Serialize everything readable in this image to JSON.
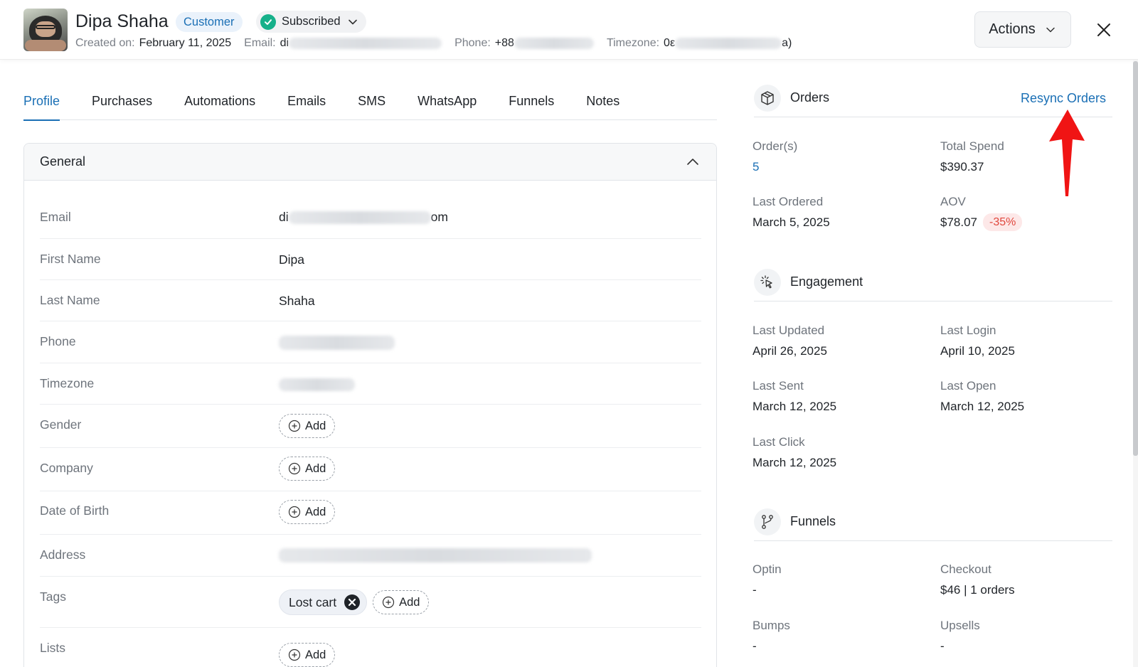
{
  "header": {
    "name": "Dipa Shaha",
    "badge": "Customer",
    "subscription_status": "Subscribed",
    "created_label": "Created on:",
    "created_value": "February 11, 2025",
    "email_label": "Email:",
    "email_visible": "di",
    "phone_label": "Phone:",
    "phone_visible": "+88",
    "timezone_label": "Timezone:",
    "timezone_visible": "0ε",
    "timezone_tail": "a)",
    "actions_label": "Actions"
  },
  "tabs": [
    {
      "label": "Profile",
      "active": true
    },
    {
      "label": "Purchases"
    },
    {
      "label": "Automations"
    },
    {
      "label": "Emails"
    },
    {
      "label": "SMS"
    },
    {
      "label": "WhatsApp"
    },
    {
      "label": "Funnels"
    },
    {
      "label": "Notes"
    }
  ],
  "general": {
    "title": "General",
    "rows": {
      "email": {
        "label": "Email",
        "value_start": "di",
        "value_end": "om"
      },
      "first_name": {
        "label": "First Name",
        "value": "Dipa"
      },
      "last_name": {
        "label": "Last Name",
        "value": "Shaha"
      },
      "phone": {
        "label": "Phone"
      },
      "timezone": {
        "label": "Timezone"
      },
      "gender": {
        "label": "Gender"
      },
      "company": {
        "label": "Company"
      },
      "date_of_birth": {
        "label": "Date of Birth"
      },
      "address": {
        "label": "Address"
      },
      "tags": {
        "label": "Tags",
        "items": [
          "Lost cart"
        ]
      },
      "lists": {
        "label": "Lists"
      }
    },
    "add_label": "Add"
  },
  "orders": {
    "title": "Orders",
    "resync_label": "Resync Orders",
    "orders_label": "Order(s)",
    "orders_value": "5",
    "total_spend_label": "Total Spend",
    "total_spend_value": "$390.37",
    "last_ordered_label": "Last Ordered",
    "last_ordered_value": "March 5, 2025",
    "aov_label": "AOV",
    "aov_value": "$78.07",
    "aov_change": "-35%"
  },
  "engagement": {
    "title": "Engagement",
    "last_updated_label": "Last Updated",
    "last_updated_value": "April 26, 2025",
    "last_login_label": "Last Login",
    "last_login_value": "April 10, 2025",
    "last_sent_label": "Last Sent",
    "last_sent_value": "March 12, 2025",
    "last_open_label": "Last Open",
    "last_open_value": "March 12, 2025",
    "last_click_label": "Last Click",
    "last_click_value": "March 12, 2025"
  },
  "funnels": {
    "title": "Funnels",
    "optin_label": "Optin",
    "optin_value": "-",
    "checkout_label": "Checkout",
    "checkout_value": "$46 | 1 orders",
    "bumps_label": "Bumps",
    "bumps_value": "-",
    "upsells_label": "Upsells",
    "upsells_value": "-"
  },
  "colors": {
    "accent": "#1a6fb5",
    "subscribed_check": "#16b08a",
    "negative": "#e0483e",
    "annotation_arrow": "#f01414"
  },
  "icons": {
    "subscribed": "check-badge-icon",
    "dropdown": "chevron-down-icon",
    "close": "close-icon",
    "collapse": "chevron-up-icon",
    "add": "plus-circle-icon",
    "tag_remove": "x-circle-icon",
    "orders": "box-icon",
    "engagement": "cursor-click-icon",
    "funnels": "git-branch-icon"
  }
}
